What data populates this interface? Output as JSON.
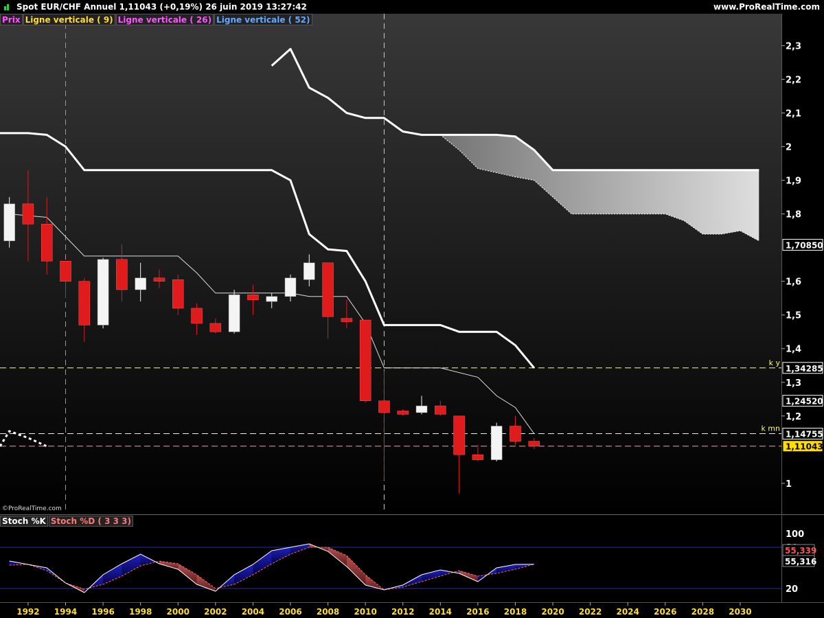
{
  "header": {
    "title": "Spot EUR/CHF   Annuel   1,11043 (+0,19%)   26 juin 2019 13:27:42",
    "site": "www.ProRealTime.com"
  },
  "legend": [
    {
      "label": "Prix",
      "color": "#ff55ff"
    },
    {
      "label": "Ligne verticale ( 9)",
      "color": "#ffdd33"
    },
    {
      "label": "Ligne verticale ( 26)",
      "color": "#ff55ff"
    },
    {
      "label": "Ligne verticale ( 52)",
      "color": "#66aaff"
    }
  ],
  "watermark": "©ProRealTime.com",
  "stoch_legend": [
    {
      "label": "Stoch %K",
      "color": "#ffffff"
    },
    {
      "label": "Stoch %D ( 3 3 3)",
      "color": "#ff7777"
    }
  ],
  "chart_data": [
    {
      "type": "candlestick",
      "title": "Spot EUR/CHF",
      "timeframe": "Annuel",
      "ylim": [
        0.91,
        2.36
      ],
      "xlim": [
        1990.5,
        2032.2
      ],
      "yticks": [
        "2,3",
        "2,2",
        "2,1",
        "2",
        "1,9",
        "1,8",
        "1,6",
        "1,5",
        "1,4",
        "1,3",
        "1,2",
        "1"
      ],
      "ytick_values": [
        2.3,
        2.2,
        2.1,
        2.0,
        1.9,
        1.8,
        1.6,
        1.5,
        1.4,
        1.3,
        1.2,
        1.0
      ],
      "xticks": [
        1992,
        1994,
        1996,
        1998,
        2000,
        2002,
        2004,
        2006,
        2008,
        2010,
        2012,
        2014,
        2016,
        2018,
        2020,
        2022,
        2024,
        2026,
        2028,
        2030
      ],
      "price_labels": [
        {
          "value": 1.7085,
          "text": "1,70850",
          "bg": "#000000",
          "fg": "#ffffff"
        },
        {
          "value": 1.34285,
          "text": "1,34285",
          "bg": "#000000",
          "fg": "#ffffff"
        },
        {
          "value": 1.2452,
          "text": "1,24520",
          "bg": "#000000",
          "fg": "#ffffff"
        },
        {
          "value": 1.14755,
          "text": "1,14755",
          "bg": "#000000",
          "fg": "#ffffff"
        },
        {
          "value": 1.11043,
          "text": "1,11043",
          "bg": "#ffdd00",
          "fg": "#000000"
        }
      ],
      "hlines": [
        {
          "value": 1.34285,
          "color": "#ffff66",
          "label": "k y"
        },
        {
          "value": 1.14755,
          "color": "#ffff66",
          "label": "k mn"
        },
        {
          "value": 1.11043,
          "color": "#ff9999",
          "label": ""
        }
      ],
      "vlines": [
        {
          "x": 1994,
          "color": "#ff55ff"
        },
        {
          "x": 2011,
          "color": "#ffcc33"
        }
      ],
      "candles": [
        {
          "x": 1991,
          "o": 1.72,
          "h": 1.85,
          "l": 1.7,
          "c": 1.83
        },
        {
          "x": 1992,
          "o": 1.83,
          "h": 1.93,
          "l": 1.66,
          "c": 1.77
        },
        {
          "x": 1993,
          "o": 1.77,
          "h": 1.85,
          "l": 1.62,
          "c": 1.66
        },
        {
          "x": 1994,
          "o": 1.66,
          "h": 1.66,
          "l": 1.55,
          "c": 1.6
        },
        {
          "x": 1995,
          "o": 1.6,
          "h": 1.61,
          "l": 1.42,
          "c": 1.47
        },
        {
          "x": 1996,
          "o": 1.47,
          "h": 1.67,
          "l": 1.46,
          "c": 1.665
        },
        {
          "x": 1997,
          "o": 1.665,
          "h": 1.71,
          "l": 1.54,
          "c": 1.575
        },
        {
          "x": 1998,
          "o": 1.575,
          "h": 1.655,
          "l": 1.54,
          "c": 1.61
        },
        {
          "x": 1999,
          "o": 1.61,
          "h": 1.635,
          "l": 1.58,
          "c": 1.6
        },
        {
          "x": 2000,
          "o": 1.605,
          "h": 1.62,
          "l": 1.5,
          "c": 1.52
        },
        {
          "x": 2001,
          "o": 1.52,
          "h": 1.535,
          "l": 1.44,
          "c": 1.475
        },
        {
          "x": 2002,
          "o": 1.475,
          "h": 1.49,
          "l": 1.445,
          "c": 1.45
        },
        {
          "x": 2003,
          "o": 1.45,
          "h": 1.575,
          "l": 1.445,
          "c": 1.56
        },
        {
          "x": 2004,
          "o": 1.56,
          "h": 1.59,
          "l": 1.5,
          "c": 1.545
        },
        {
          "x": 2005,
          "o": 1.54,
          "h": 1.565,
          "l": 1.52,
          "c": 1.555
        },
        {
          "x": 2006,
          "o": 1.555,
          "h": 1.62,
          "l": 1.54,
          "c": 1.61
        },
        {
          "x": 2007,
          "o": 1.605,
          "h": 1.68,
          "l": 1.585,
          "c": 1.655
        },
        {
          "x": 2008,
          "o": 1.655,
          "h": 1.655,
          "l": 1.43,
          "c": 1.495
        },
        {
          "x": 2009,
          "o": 1.49,
          "h": 1.545,
          "l": 1.46,
          "c": 1.48
        },
        {
          "x": 2010,
          "o": 1.485,
          "h": 1.485,
          "l": 1.24,
          "c": 1.245
        },
        {
          "x": 2011,
          "o": 1.245,
          "h": 1.335,
          "l": 1.01,
          "c": 1.21
        },
        {
          "x": 2012,
          "o": 1.215,
          "h": 1.22,
          "l": 1.2,
          "c": 1.205
        },
        {
          "x": 2013,
          "o": 1.21,
          "h": 1.26,
          "l": 1.205,
          "c": 1.23
        },
        {
          "x": 2014,
          "o": 1.23,
          "h": 1.245,
          "l": 1.2,
          "c": 1.205
        },
        {
          "x": 2015,
          "o": 1.2,
          "h": 1.2,
          "l": 0.97,
          "c": 1.085
        },
        {
          "x": 2016,
          "o": 1.085,
          "h": 1.115,
          "l": 1.065,
          "c": 1.07
        },
        {
          "x": 2017,
          "o": 1.07,
          "h": 1.18,
          "l": 1.065,
          "c": 1.17
        },
        {
          "x": 2018,
          "o": 1.17,
          "h": 1.2,
          "l": 1.115,
          "c": 1.125
        },
        {
          "x": 2019,
          "o": 1.125,
          "h": 1.135,
          "l": 1.102,
          "c": 1.11043
        }
      ],
      "kijun_line": [
        [
          1991,
          1.8
        ],
        [
          1993,
          1.79
        ],
        [
          1995,
          1.675
        ],
        [
          1997,
          1.675
        ],
        [
          2000,
          1.675
        ],
        [
          2001,
          1.625
        ],
        [
          2002,
          1.565
        ],
        [
          2006,
          1.565
        ],
        [
          2007,
          1.555
        ],
        [
          2009,
          1.555
        ],
        [
          2010,
          1.475
        ],
        [
          2011,
          1.34285
        ],
        [
          2014,
          1.34285
        ],
        [
          2016,
          1.315
        ],
        [
          2017,
          1.26
        ],
        [
          2018,
          1.225
        ],
        [
          2019,
          1.14755
        ]
      ],
      "thick_line_a": [
        [
          1990.5,
          2.04
        ],
        [
          1992,
          2.04
        ],
        [
          1993,
          2.035
        ],
        [
          1994,
          2.0
        ],
        [
          1995,
          1.93
        ],
        [
          2005,
          1.93
        ],
        [
          2006,
          1.9
        ],
        [
          2007,
          1.74
        ],
        [
          2008,
          1.695
        ],
        [
          2009,
          1.69
        ],
        [
          2010,
          1.6
        ],
        [
          2011,
          1.47
        ],
        [
          2014,
          1.47
        ],
        [
          2015,
          1.45
        ],
        [
          2017,
          1.45
        ],
        [
          2018,
          1.41
        ],
        [
          2019,
          1.34285
        ]
      ],
      "thick_line_b": [
        [
          2005,
          2.24
        ],
        [
          2006,
          2.29
        ],
        [
          2007,
          2.175
        ],
        [
          2008,
          2.145
        ],
        [
          2009,
          2.1
        ],
        [
          2010,
          2.085
        ],
        [
          2011,
          2.085
        ],
        [
          2012,
          2.045
        ],
        [
          2013,
          2.035
        ],
        [
          2017,
          2.035
        ],
        [
          2018,
          2.03
        ],
        [
          2019,
          1.99
        ],
        [
          2020,
          1.93
        ],
        [
          2031,
          1.93
        ]
      ],
      "cloud_lower": [
        [
          2014,
          2.035
        ],
        [
          2015,
          1.99
        ],
        [
          2016,
          1.935
        ],
        [
          2018,
          1.91
        ],
        [
          2019,
          1.9
        ],
        [
          2020,
          1.85
        ],
        [
          2021,
          1.8
        ],
        [
          2026,
          1.8
        ],
        [
          2027,
          1.78
        ],
        [
          2028,
          1.74
        ],
        [
          2029,
          1.74
        ],
        [
          2030,
          1.75
        ],
        [
          2031,
          1.72
        ]
      ],
      "dotted_line": [
        [
          1990.5,
          1.11
        ],
        [
          1991,
          1.155
        ],
        [
          1992,
          1.135
        ],
        [
          1993,
          1.11
        ]
      ]
    },
    {
      "type": "line",
      "title": "Stoch %K / Stoch %D ( 3 3 3)",
      "ylim": [
        0,
        108
      ],
      "yticks": [
        "100",
        "80",
        "20"
      ],
      "ytick_values": [
        100,
        80,
        20
      ],
      "levels": [
        80,
        20
      ],
      "value_labels": [
        {
          "value": 55.339,
          "text": "55,339",
          "color": "#ff5555"
        },
        {
          "value": 55.316,
          "text": "55,316",
          "color": "#ffffff"
        }
      ],
      "series": [
        {
          "name": "Stoch %K",
          "values": [
            [
              1991,
              60
            ],
            [
              1992,
              55
            ],
            [
              1993,
              50
            ],
            [
              1994,
              28
            ],
            [
              1995,
              14
            ],
            [
              1996,
              40
            ],
            [
              1997,
              56
            ],
            [
              1998,
              70
            ],
            [
              1999,
              56
            ],
            [
              2000,
              48
            ],
            [
              2001,
              26
            ],
            [
              2002,
              16
            ],
            [
              2003,
              40
            ],
            [
              2004,
              55
            ],
            [
              2005,
              75
            ],
            [
              2006,
              80
            ],
            [
              2007,
              85
            ],
            [
              2008,
              74
            ],
            [
              2009,
              52
            ],
            [
              2010,
              25
            ],
            [
              2011,
              18
            ],
            [
              2012,
              25
            ],
            [
              2013,
              40
            ],
            [
              2014,
              47
            ],
            [
              2015,
              42
            ],
            [
              2016,
              30
            ],
            [
              2017,
              50
            ],
            [
              2018,
              55
            ],
            [
              2019,
              55.316
            ]
          ]
        },
        {
          "name": "Stoch %D",
          "values": [
            [
              1991,
              54
            ],
            [
              1992,
              55
            ],
            [
              1993,
              46
            ],
            [
              1994,
              28
            ],
            [
              1995,
              19
            ],
            [
              1996,
              26
            ],
            [
              1997,
              38
            ],
            [
              1998,
              53
            ],
            [
              1999,
              60
            ],
            [
              2000,
              56
            ],
            [
              2001,
              40
            ],
            [
              2002,
              20
            ],
            [
              2003,
              26
            ],
            [
              2004,
              40
            ],
            [
              2005,
              56
            ],
            [
              2006,
              70
            ],
            [
              2007,
              80
            ],
            [
              2008,
              80
            ],
            [
              2009,
              68
            ],
            [
              2010,
              40
            ],
            [
              2011,
              18
            ],
            [
              2012,
              22
            ],
            [
              2013,
              30
            ],
            [
              2014,
              38
            ],
            [
              2015,
              46
            ],
            [
              2016,
              38
            ],
            [
              2017,
              42
            ],
            [
              2018,
              48
            ],
            [
              2019,
              55.339
            ]
          ]
        }
      ]
    }
  ]
}
